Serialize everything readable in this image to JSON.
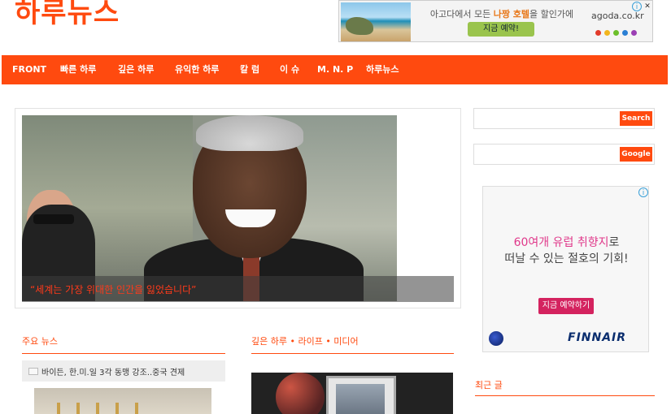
{
  "site": {
    "title": "하루뉴스"
  },
  "top_ad": {
    "text_prefix": "아고다에서 모든 ",
    "text_highlight": "나짱 호텔",
    "text_suffix": "을 할인가에",
    "cta": "지금 예약!",
    "brand": "agoda.co.kr",
    "dot_colors": [
      "#e23a2a",
      "#f2b51c",
      "#6cbf2a",
      "#2a7fd4",
      "#9b3fb4"
    ],
    "info_icon": "info-icon",
    "close_icon": "close-icon"
  },
  "nav": {
    "items": [
      "FRONT",
      "빠른 하루",
      "깊은 하루",
      "유익한 하루",
      "칼 럼",
      "이 슈",
      "M. N. P",
      "하루뉴스"
    ]
  },
  "slider": {
    "caption": "“세계는 가장 위대한 인간을 잃었습니다”"
  },
  "sections": {
    "main_news": "주요 뉴스",
    "deep_day": "깊은 하루 • 라이프 • 미디어"
  },
  "news": {
    "item1": "바이든, 한.미.일 3각 동맹 강조..중국 견제"
  },
  "sidebar": {
    "search_button": "Search",
    "google_button": "Google",
    "recent_posts": "최근 글"
  },
  "side_ad": {
    "line1_a": "60여개 유럽 ",
    "line1_b": "취향지",
    "line1_c": "로",
    "line2": "떠날 수 있는 절호의 기회!",
    "cta": "지금 예약하기",
    "brand": "FINNAIR"
  },
  "colors": {
    "accent": "#ff4a0f"
  }
}
